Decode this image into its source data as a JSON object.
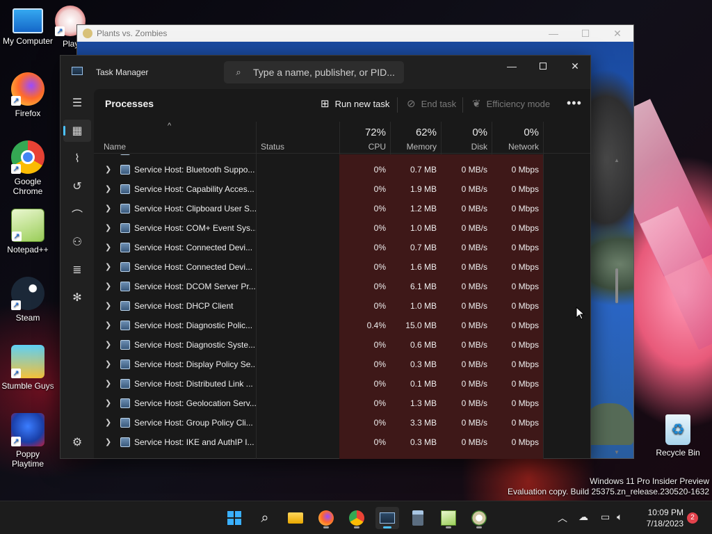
{
  "desktop": {
    "icons": [
      {
        "label": "My Computer"
      },
      {
        "label": "Firefox"
      },
      {
        "label": "Google Chrome"
      },
      {
        "label": "Notepad++"
      },
      {
        "label": "Steam"
      },
      {
        "label": "Stumble Guys"
      },
      {
        "label": "Poppy Playtime"
      },
      {
        "label": "Play"
      },
      {
        "label": "Recycle Bin"
      }
    ],
    "watermark_line1": "Windows 11 Pro Insider Preview",
    "watermark_line2": "Evaluation copy. Build 25375.zn_release.230520-1632"
  },
  "pvz_window": {
    "title": "Plants vs. Zombies"
  },
  "task_manager": {
    "title": "Task Manager",
    "search_placeholder": "Type a name, publisher, or PID...",
    "page_title": "Processes",
    "commands": {
      "run_new_task": "Run new task",
      "end_task": "End task",
      "efficiency_mode": "Efficiency mode",
      "more": "•••"
    },
    "columns": {
      "name": "Name",
      "status": "Status",
      "cpu_pct": "72%",
      "cpu": "CPU",
      "memory_pct": "62%",
      "memory": "Memory",
      "disk_pct": "0%",
      "disk": "Disk",
      "network_pct": "0%",
      "network": "Network"
    },
    "rows": [
      {
        "name": "Service Host: Bluetooth Suppo...",
        "cpu": "0%",
        "memory": "0.7 MB",
        "disk": "0 MB/s",
        "network": "0 Mbps"
      },
      {
        "name": "Service Host: Capability Acces...",
        "cpu": "0%",
        "memory": "1.9 MB",
        "disk": "0 MB/s",
        "network": "0 Mbps"
      },
      {
        "name": "Service Host: Clipboard User S...",
        "cpu": "0%",
        "memory": "1.2 MB",
        "disk": "0 MB/s",
        "network": "0 Mbps"
      },
      {
        "name": "Service Host: COM+ Event Sys...",
        "cpu": "0%",
        "memory": "1.0 MB",
        "disk": "0 MB/s",
        "network": "0 Mbps"
      },
      {
        "name": "Service Host: Connected Devi...",
        "cpu": "0%",
        "memory": "0.7 MB",
        "disk": "0 MB/s",
        "network": "0 Mbps"
      },
      {
        "name": "Service Host: Connected Devi...",
        "cpu": "0%",
        "memory": "1.6 MB",
        "disk": "0 MB/s",
        "network": "0 Mbps"
      },
      {
        "name": "Service Host: DCOM Server Pr...",
        "cpu": "0%",
        "memory": "6.1 MB",
        "disk": "0 MB/s",
        "network": "0 Mbps"
      },
      {
        "name": "Service Host: DHCP Client",
        "cpu": "0%",
        "memory": "1.0 MB",
        "disk": "0 MB/s",
        "network": "0 Mbps"
      },
      {
        "name": "Service Host: Diagnostic Polic...",
        "cpu": "0.4%",
        "memory": "15.0 MB",
        "disk": "0 MB/s",
        "network": "0 Mbps"
      },
      {
        "name": "Service Host: Diagnostic Syste...",
        "cpu": "0%",
        "memory": "0.6 MB",
        "disk": "0 MB/s",
        "network": "0 Mbps"
      },
      {
        "name": "Service Host: Display Policy Se...",
        "cpu": "0%",
        "memory": "0.3 MB",
        "disk": "0 MB/s",
        "network": "0 Mbps"
      },
      {
        "name": "Service Host: Distributed Link ...",
        "cpu": "0%",
        "memory": "0.1 MB",
        "disk": "0 MB/s",
        "network": "0 Mbps"
      },
      {
        "name": "Service Host: Geolocation Serv...",
        "cpu": "0%",
        "memory": "1.3 MB",
        "disk": "0 MB/s",
        "network": "0 Mbps"
      },
      {
        "name": "Service Host: Group Policy Cli...",
        "cpu": "0%",
        "memory": "3.3 MB",
        "disk": "0 MB/s",
        "network": "0 Mbps"
      },
      {
        "name": "Service Host: IKE and AuthIP I...",
        "cpu": "0%",
        "memory": "0.3 MB",
        "disk": "0 MB/s",
        "network": "0 Mbps"
      }
    ]
  },
  "taskbar": {
    "time": "10:09 PM",
    "date": "7/18/2023",
    "notification_count": "2"
  },
  "colors": {
    "accent": "#4cc2ff",
    "heat": "#3e1818",
    "tm_bg": "#202020"
  }
}
